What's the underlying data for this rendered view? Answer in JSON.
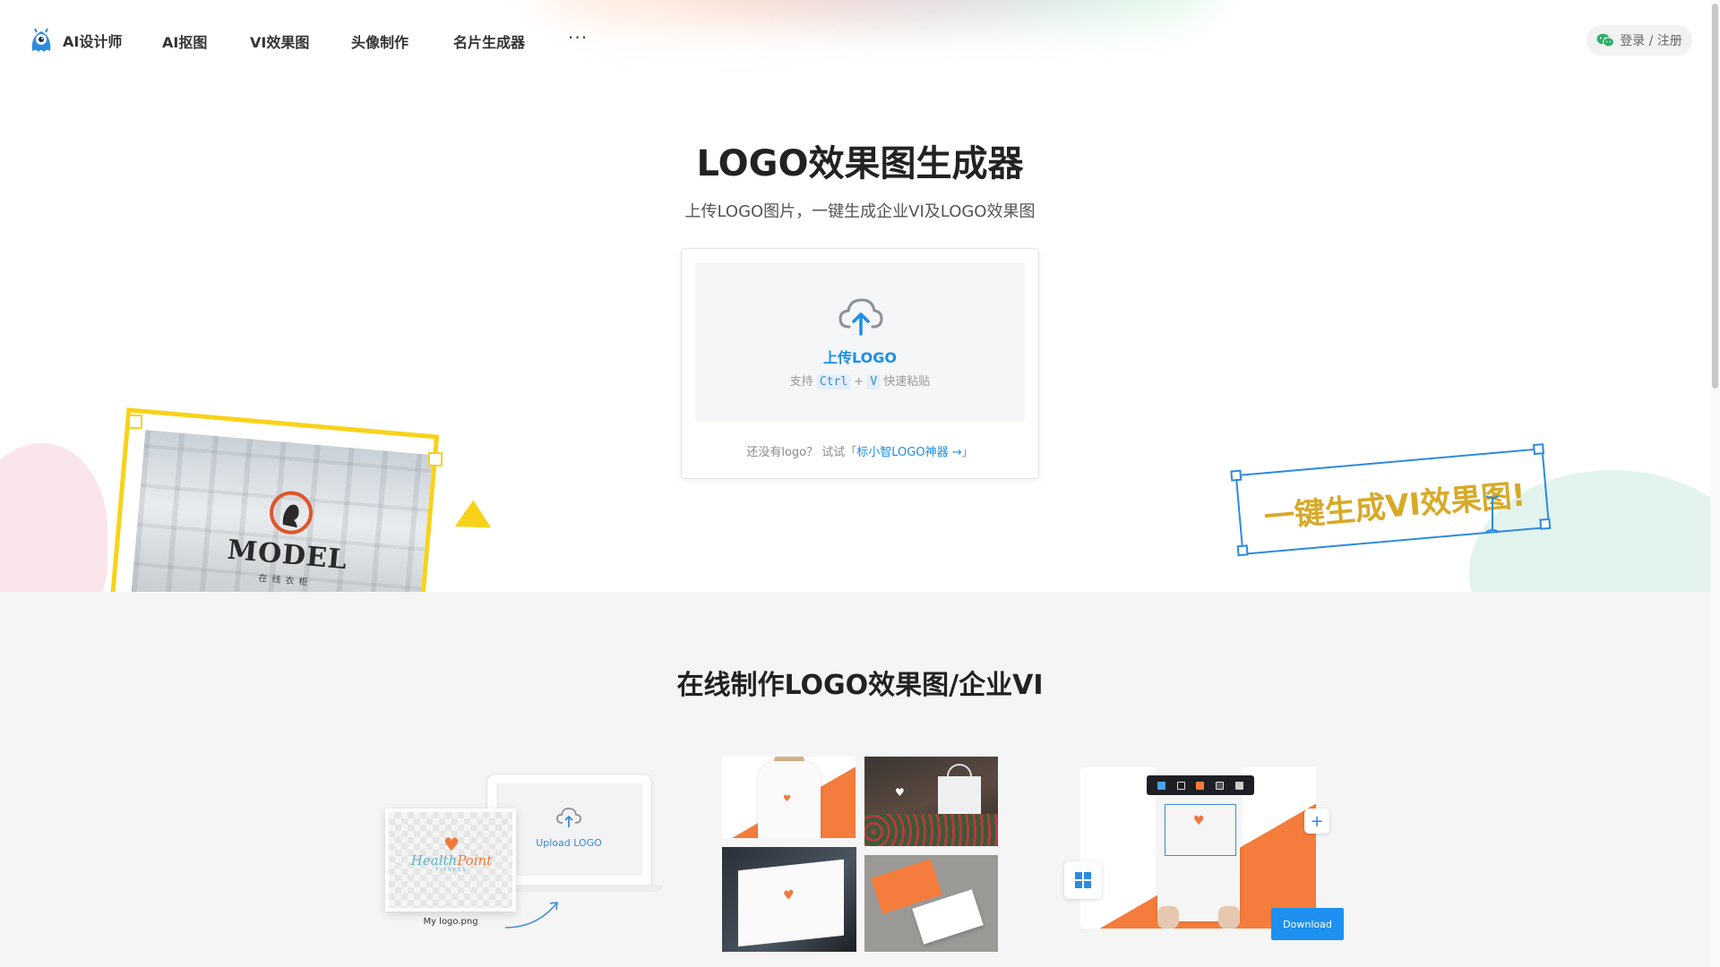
{
  "nav": {
    "brand": "AI设计师",
    "items": [
      "AI抠图",
      "VI效果图",
      "头像制作",
      "名片生成器"
    ],
    "more": "···",
    "login": "登录 / 注册"
  },
  "hero": {
    "title": "LOGO效果图生成器",
    "subtitle": "上传LOGO图片，一键生成企业VI及LOGO效果图",
    "upload_label": "上传LOGO",
    "paste_prefix": "支持",
    "paste_key1": "Ctrl",
    "paste_plus": "+",
    "paste_key2": "V",
    "paste_suffix": "快速粘贴",
    "nologo_text": "还没有logo？ 试试「",
    "nologo_link": "标小智LOGO神器 →",
    "nologo_close": "」",
    "decor_left_word": "MODEL",
    "decor_left_sub": "在线衣柜",
    "decor_right_text": "一键生成VI效果图!"
  },
  "section2": {
    "title": "在线制作LOGO效果图/企业VI",
    "upload_logo": "Upload LOGO",
    "file_caption": "My logo.png",
    "hp_name_a": "Health",
    "hp_name_b": "Point",
    "hp_fitness": "FITNESS",
    "download": "Download"
  },
  "colors": {
    "accent_blue": "#1a8fe8",
    "yellow": "#f8d21a",
    "orange": "#f47c3c",
    "wechat_green": "#2aae67"
  }
}
